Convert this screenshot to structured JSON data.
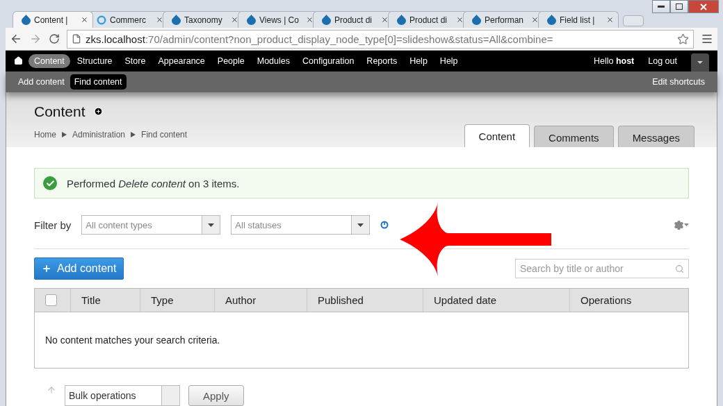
{
  "browser": {
    "tabs": [
      {
        "title": "Content |",
        "kind": "drop",
        "selected": true
      },
      {
        "title": "Commerc",
        "kind": "ring",
        "selected": false
      },
      {
        "title": "Taxonomy",
        "kind": "drop",
        "selected": false
      },
      {
        "title": "Views | Co",
        "kind": "drop",
        "selected": false
      },
      {
        "title": "Product di",
        "kind": "drop",
        "selected": false
      },
      {
        "title": "Product di",
        "kind": "drop",
        "selected": false
      },
      {
        "title": "Performan",
        "kind": "drop",
        "selected": false
      },
      {
        "title": "Field list |",
        "kind": "drop",
        "selected": false
      }
    ],
    "address": {
      "host": "zks.localhost",
      "rest": ":70/admin/content?non_product_display_node_type[0]=slideshow&status=All&combine="
    }
  },
  "toolbar": {
    "menu": [
      {
        "label": "Content",
        "selected": true
      },
      {
        "label": "Structure",
        "selected": false
      },
      {
        "label": "Store",
        "selected": false
      },
      {
        "label": "Appearance",
        "selected": false
      },
      {
        "label": "People",
        "selected": false
      },
      {
        "label": "Modules",
        "selected": false
      },
      {
        "label": "Configuration",
        "selected": false
      },
      {
        "label": "Reports",
        "selected": false
      },
      {
        "label": "Help",
        "selected": false
      },
      {
        "label": "Help",
        "selected": false
      }
    ],
    "greeting": "Hello **host**",
    "logout": "Log out"
  },
  "shortcuts": {
    "items": [
      {
        "label": "Add content",
        "selected": false
      },
      {
        "label": "Find content",
        "selected": true
      }
    ],
    "edit": "Edit shortcuts"
  },
  "header": {
    "title": "Content",
    "breadcrumb": [
      "Home",
      "Administration",
      "Find content"
    ],
    "tabs": [
      {
        "label": "Content",
        "selected": true
      },
      {
        "label": "Comments",
        "selected": false
      },
      {
        "label": "Messages",
        "selected": false
      }
    ]
  },
  "message": {
    "text": "Performed *Delete content* on 3 items."
  },
  "filter": {
    "label": "Filter by",
    "selects": [
      {
        "placeholder": "All content types"
      },
      {
        "placeholder": "All statuses"
      }
    ]
  },
  "add_button": "Add content",
  "search": {
    "placeholder": "Search by title or author"
  },
  "table": {
    "select_all": {
      "checked": false
    },
    "columns": [
      "Title",
      "Type",
      "Author",
      "Published",
      "Updated date",
      "Operations"
    ],
    "empty": "No content matches your search criteria."
  },
  "bulk": {
    "select": "Bulk operations",
    "apply": "Apply"
  }
}
